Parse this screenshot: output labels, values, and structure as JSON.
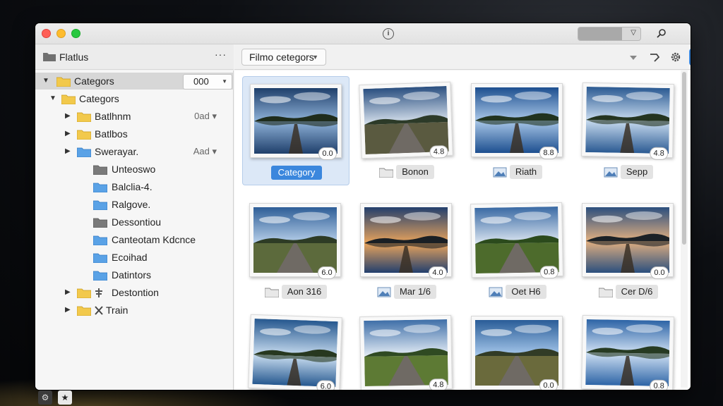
{
  "window": {
    "title_icon": "info-icon"
  },
  "sidebar": {
    "title": "Flatlus",
    "more_label": "···",
    "count_dropdown": "000",
    "items": [
      {
        "label": "Categors",
        "meta": ""
      },
      {
        "label": "Categors",
        "meta": ""
      },
      {
        "label": "Batlhnm",
        "meta": "0ad"
      },
      {
        "label": "Batlbos",
        "meta": ""
      },
      {
        "label": "Swerayar.",
        "meta": "Aad"
      },
      {
        "label": "Unteoswo",
        "meta": ""
      },
      {
        "label": "Balclia-4.",
        "meta": ""
      },
      {
        "label": "Ralgove.",
        "meta": ""
      },
      {
        "label": "Dessontiou",
        "meta": ""
      },
      {
        "label": "Canteotam Kdcnce",
        "meta": ""
      },
      {
        "label": "Ecoihad",
        "meta": ""
      },
      {
        "label": "Datintors",
        "meta": ""
      },
      {
        "label": "Destontion",
        "meta": ""
      },
      {
        "label": "Train",
        "meta": ""
      }
    ]
  },
  "toolbar": {
    "filter_label": "Filmo cetegors"
  },
  "grid": {
    "tiles": [
      {
        "caption": "Category",
        "rating": "0.0"
      },
      {
        "caption": "Bonon",
        "rating": "4.8"
      },
      {
        "caption": "Riath",
        "rating": "8.8"
      },
      {
        "caption": "Sepp",
        "rating": "4.8"
      },
      {
        "caption": "Aon 316",
        "rating": "6.0"
      },
      {
        "caption": "Mar 1/6",
        "rating": "4.0"
      },
      {
        "caption": "Oet H6",
        "rating": "0.8"
      },
      {
        "caption": "Cer D/6",
        "rating": "0.0"
      },
      {
        "caption": "",
        "rating": "6.0"
      },
      {
        "caption": "",
        "rating": "4.8"
      },
      {
        "caption": "",
        "rating": "0.0"
      },
      {
        "caption": "",
        "rating": "0.8"
      }
    ]
  },
  "colors": {
    "accent": "#3b87dd",
    "selection": "#dce8f7",
    "folder_yellow": "#f2c94c",
    "folder_blue": "#5aa2e6"
  }
}
